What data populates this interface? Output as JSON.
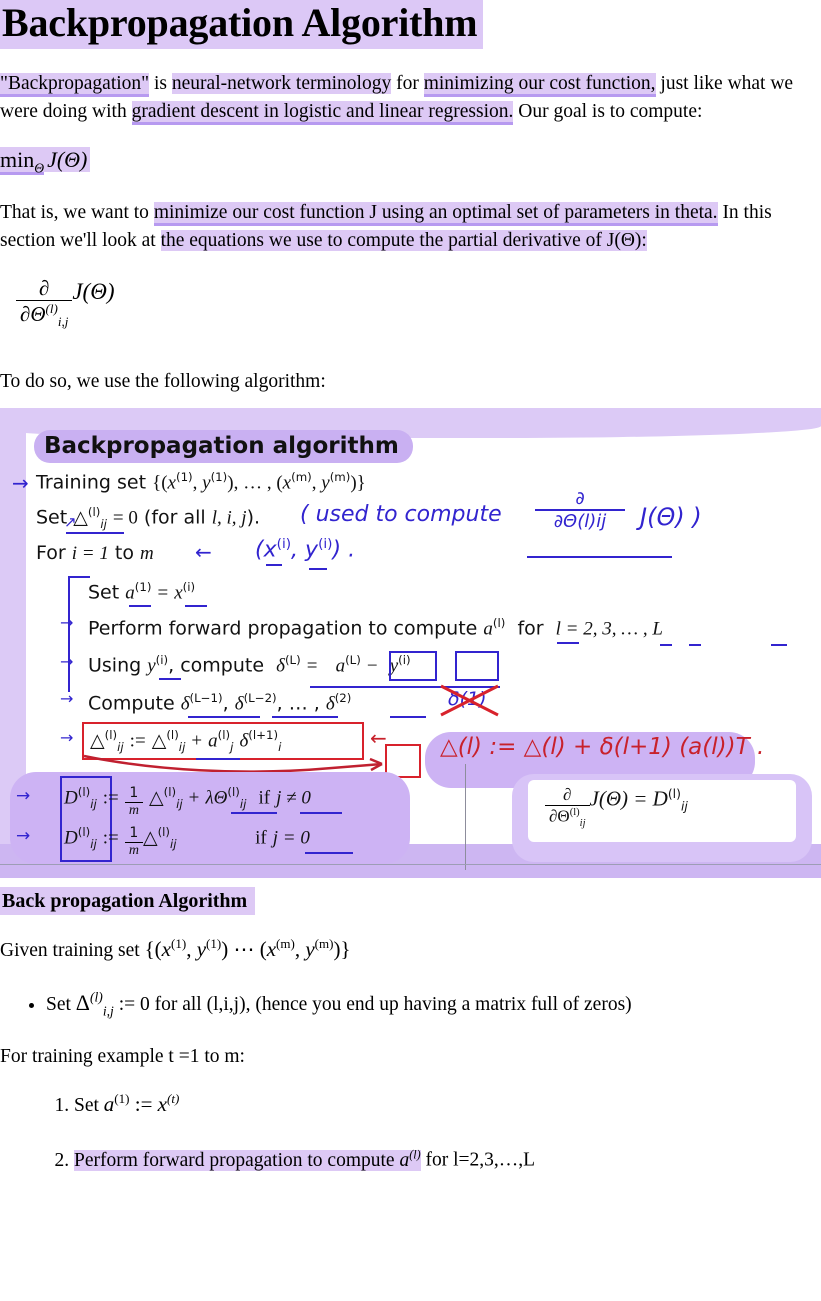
{
  "document": {
    "title": "Backpropagation Algorithm"
  },
  "intro": {
    "seg1": "\"Backpropagation\"",
    "seg2": " is ",
    "seg3": "neural-network terminology",
    "seg4": " for ",
    "seg5": "minimizing our cost function,",
    "seg6": " just like what we were doing with ",
    "seg7": "gradient descent in logistic and linear regression.",
    "seg8": " Our goal is to compute:"
  },
  "equation_min": {
    "min_label": "min",
    "min_sub": "Θ",
    "body": "J(Θ)"
  },
  "para2": {
    "seg1": "That is, we want to ",
    "seg2": "minimize our cost function J using an optimal set of parameters in theta.",
    "seg3": " In this section we'll look at ",
    "seg4": "the equations we use to compute the partial derivative of J(Θ):"
  },
  "equation_partial": {
    "numerator": "∂",
    "denominator_base": "∂Θ",
    "denominator_sup": "(l)",
    "denominator_sub": "i,j",
    "tail": "J(Θ)"
  },
  "lead_in": {
    "text": "To do so, we use the following algorithm:"
  },
  "slide": {
    "title": "Backpropagation algorithm",
    "lines": {
      "training_set_label": "Training set",
      "training_set_math": "{(x(1), y(1)), … , (x(m), y(m))}",
      "set_delta": "Set △(l)ij = 0 (for all l, i, j).",
      "for_loop": "For i = 1 to m",
      "set_a": "Set a(1) = x(i)",
      "forward_prop": "Perform forward propagation to compute a(l) for l = 2, 3, … , L",
      "using_y": "Using y(i), compute δ(L) = a(L) − y(i)",
      "compute_deltas": "Compute δ(L−1), δ(L−2), … , δ(2)",
      "delta_update": "△(l)ij := △(l)ij + a(l)j δ(l+1)i",
      "d_nonzero": "D(l)ij := (1/m) △(l)ij + λΘ(l)ij   if j ≠ 0",
      "d_zero": "D(l)ij := (1/m) △(l)ij   if j = 0"
    },
    "annotations": {
      "blue_note": "( used to compute",
      "blue_note_frac_top": "∂",
      "blue_note_frac_bot": "∂Θ(l)ij",
      "blue_note_tail": "J(Θ) )",
      "blue_xy": "(x(i), y(i)) .",
      "red_crossed": "δ(1)",
      "red_formula": "△(l) := △(l) + δ(l+1) (a(l))T .",
      "purple_box_formula_frac_top": "∂",
      "purple_box_formula_frac_bot": "∂Θ(l)ij",
      "purple_box_formula_tail": "J(Θ) = D(l)ij"
    },
    "arrow_glyph": "→",
    "left_arrow_glyph": "←"
  },
  "section2": {
    "heading": "Back propagation Algorithm",
    "given": "Given training set {(x(1), y(1)) ⋯ (x(m), y(m))}",
    "bullet1": "Set Δ(l)i,j := 0 for all (l,i,j), (hence you end up having a matrix full of zeros)",
    "for_training": "For training example t =1 to m:",
    "step1": "Set a(1) := x(t)",
    "step2_hl": "Perform forward propagation to compute a(l)",
    "step2_tail": " for l=2,3,…,L"
  },
  "colors": {
    "highlight": "#ddc9f5",
    "highlight_title": "#dcc8f6",
    "highlight_underline": "#b79af0",
    "slide_wash": "#dccaf6",
    "slide_wash_strong": "#cdb6f2",
    "hand_blue": "#3224cf",
    "hand_red": "#c8212b"
  }
}
